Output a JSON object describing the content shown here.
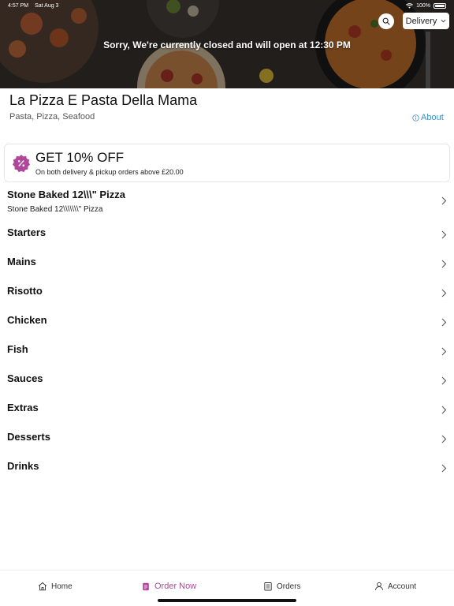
{
  "status_bar": {
    "time": "4:57 PM",
    "date": "Sat Aug 3",
    "battery": "100%"
  },
  "hero": {
    "closed_message": "Sorry, We're currently closed and will open at 12:30 PM",
    "delivery_label": "Delivery"
  },
  "restaurant": {
    "name": "La Pizza E Pasta Della Mama",
    "cuisines": "Pasta, Pizza, Seafood",
    "about_label": "About"
  },
  "promo": {
    "title": "GET 10% OFF",
    "subtitle": "On both delivery & pickup orders above £20.00",
    "accent": "#b0479b"
  },
  "categories": [
    {
      "label": "Stone Baked 12\\\\\\\" Pizza",
      "sub": "Stone Baked 12\\\\\\\\\\\\\\\" Pizza"
    },
    {
      "label": "Starters"
    },
    {
      "label": "Mains"
    },
    {
      "label": "Risotto"
    },
    {
      "label": "Chicken"
    },
    {
      "label": "Fish"
    },
    {
      "label": "Sauces"
    },
    {
      "label": "Extras"
    },
    {
      "label": "Desserts"
    },
    {
      "label": "Drinks"
    }
  ],
  "bottom_nav": {
    "home": "Home",
    "order_now": "Order Now",
    "orders": "Orders",
    "account": "Account",
    "active": "order_now"
  },
  "colors": {
    "accent": "#b0479b",
    "link": "#3b8fc6"
  }
}
